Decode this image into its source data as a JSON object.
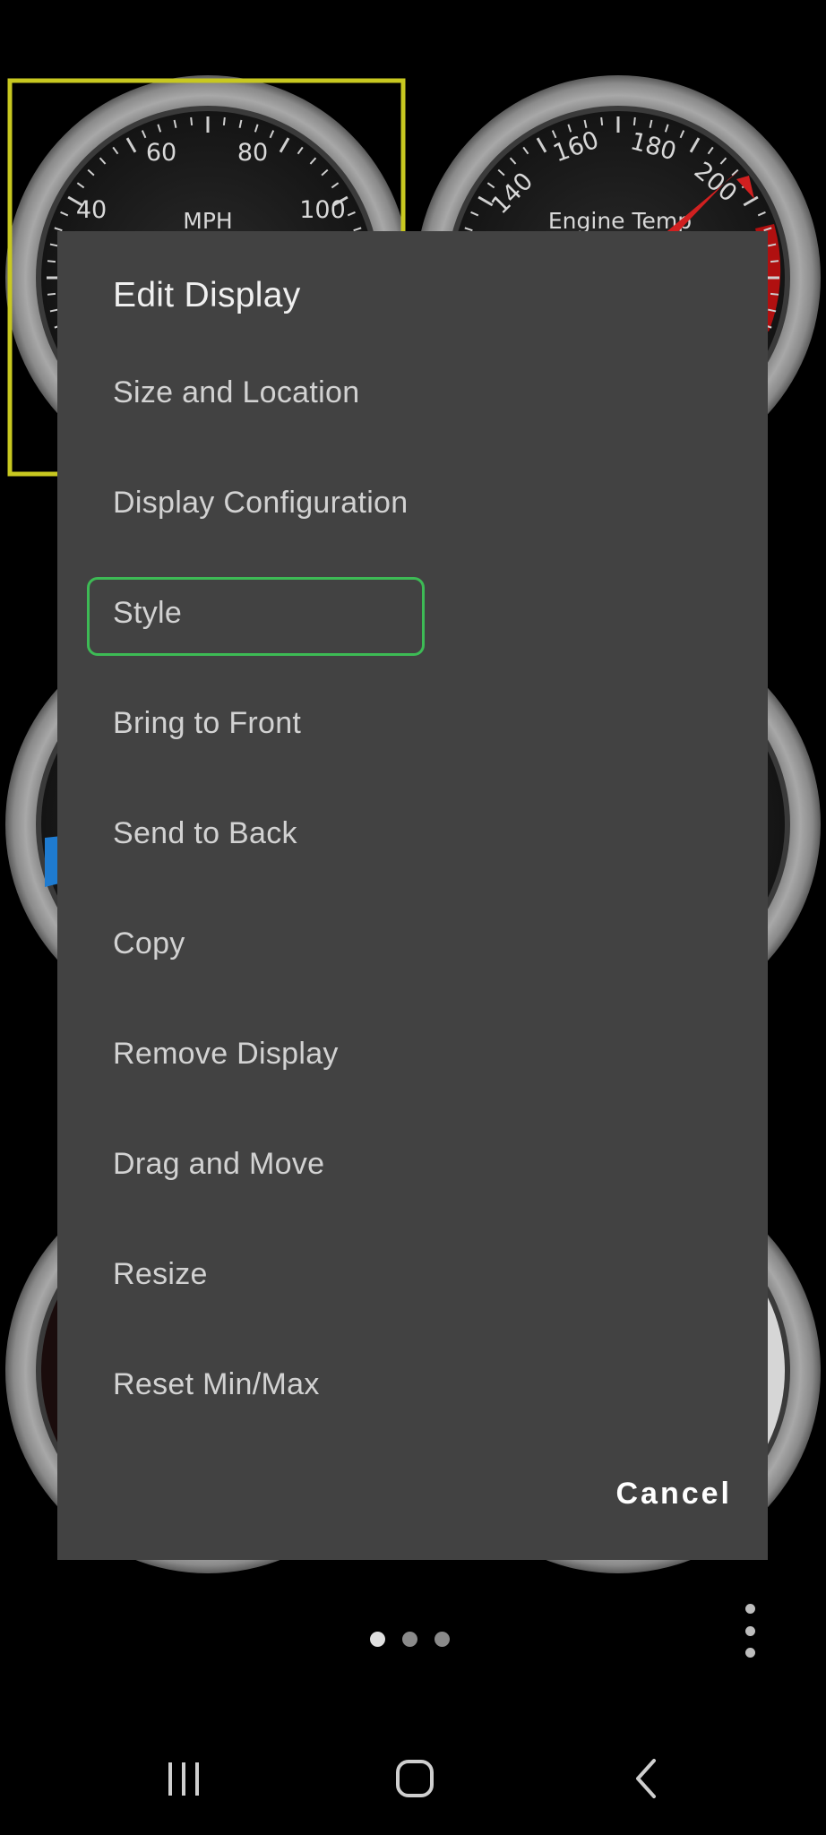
{
  "gauges": {
    "speedometer": {
      "title": "MPH",
      "tick_labels": [
        "40",
        "60",
        "80",
        "100"
      ]
    },
    "engine_temp": {
      "title": "Engine Temp",
      "tick_labels": [
        "140",
        "160",
        "180",
        "200"
      ]
    }
  },
  "dialog": {
    "title": "Edit Display",
    "items": [
      {
        "label": "Size and Location"
      },
      {
        "label": "Display Configuration"
      },
      {
        "label": "Style",
        "focused": true
      },
      {
        "label": "Bring to Front"
      },
      {
        "label": "Send to Back"
      },
      {
        "label": "Copy"
      },
      {
        "label": "Remove Display"
      },
      {
        "label": "Drag and Move"
      },
      {
        "label": "Resize"
      },
      {
        "label": "Reset Min/Max"
      }
    ],
    "cancel_label": "Cancel"
  },
  "pager": {
    "page_count": 3,
    "current_page": 1
  },
  "nav_bar": {
    "icons": [
      "recent-apps-icon",
      "home-icon",
      "back-icon"
    ]
  },
  "colors": {
    "dialog_bg": "#424242",
    "selection_box": "#c8c820",
    "focus_ring": "#3dbb55",
    "needle": "#d02020",
    "temp_red_zone": "#b01010",
    "blue_zone": "#1e7bd0"
  }
}
